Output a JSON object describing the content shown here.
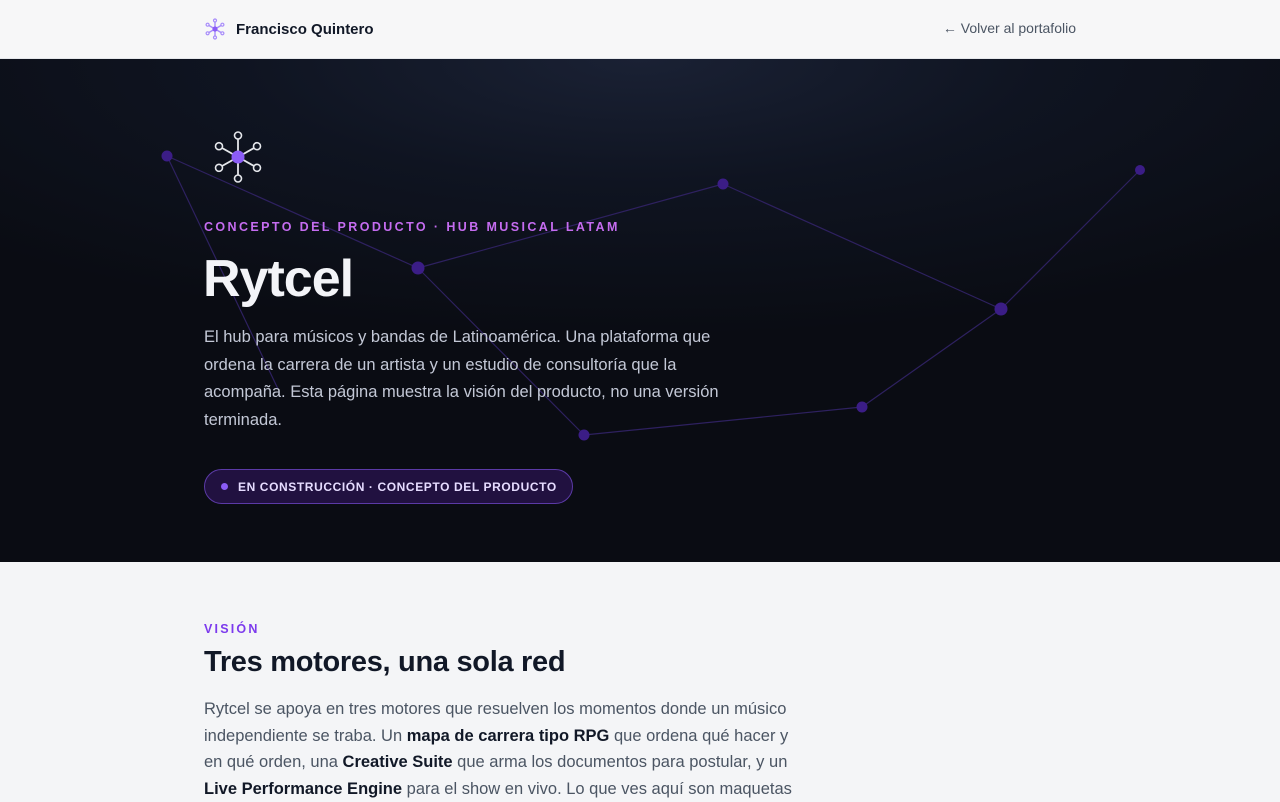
{
  "header": {
    "brand_name": "Francisco Quintero",
    "back_link": "← Volver al portafolio"
  },
  "hero": {
    "eyebrow": "CONCEPTO DEL PRODUCTO · HUB MUSICAL LATAM",
    "title": "Rytcel",
    "description": "El hub para músicos y bandas de Latinoamérica. Una plataforma que ordena la carrera de un artista y un estudio de consultoría que la acompaña. Esta página muestra la visión del producto, no una versión terminada.",
    "status_label": "EN CONSTRUCCIÓN · CONCEPTO DEL PRODUCTO"
  },
  "vision": {
    "eyebrow": "VISIÓN",
    "title": "Tres motores, una sola red",
    "p_1": "Rytcel se apoya en tres motores que resuelven los momentos donde un músico independiente se traba. Un ",
    "b_1": "mapa de carrera tipo RPG",
    "p_2": " que ordena qué hacer y en qué orden, una ",
    "b_2": "Creative Suite",
    "p_3": " que arma los documentos para postular, y un ",
    "b_3": "Live Performance Engine",
    "p_4": " para el show en vivo. Lo que ves aquí son maquetas"
  },
  "colors": {
    "accent": "#7c3aed",
    "accent_light": "#c56cf0",
    "hero_bg": "#0a0c13",
    "node": "#3b1d86"
  },
  "icons": {
    "brand": "network-hub-icon",
    "hero": "network-hub-icon"
  }
}
